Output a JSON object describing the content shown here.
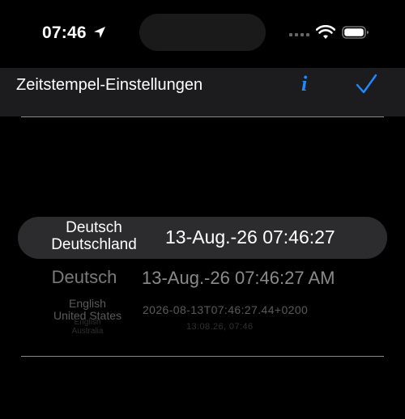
{
  "status_bar": {
    "time": "07:46",
    "icons": [
      "location-arrow-icon",
      "signal-icon",
      "wifi-icon",
      "battery-icon"
    ]
  },
  "nav": {
    "title": "Zeitstempel-Einstellungen",
    "info_label": "i",
    "accent_color": "#1e8bff",
    "confirm_icon": "checkmark-icon"
  },
  "picker": {
    "rows": [
      {
        "locale_line1": "Deutsch",
        "locale_line2": "Deutschland",
        "timestamp": "13-Aug.-26 07:46:27",
        "selected": true
      },
      {
        "locale_line1": "Deutsch",
        "locale_line2": "",
        "timestamp": "13-Aug.-26 07:46:27 AM",
        "selected": false
      },
      {
        "locale_line1": "English",
        "locale_line2": "United States",
        "timestamp": "2026-08-13T07:46:27.44+0200",
        "selected": false
      },
      {
        "locale_line1": "English",
        "locale_line2": "Australia",
        "timestamp": "13.08.26, 07:46",
        "selected": false
      }
    ]
  }
}
